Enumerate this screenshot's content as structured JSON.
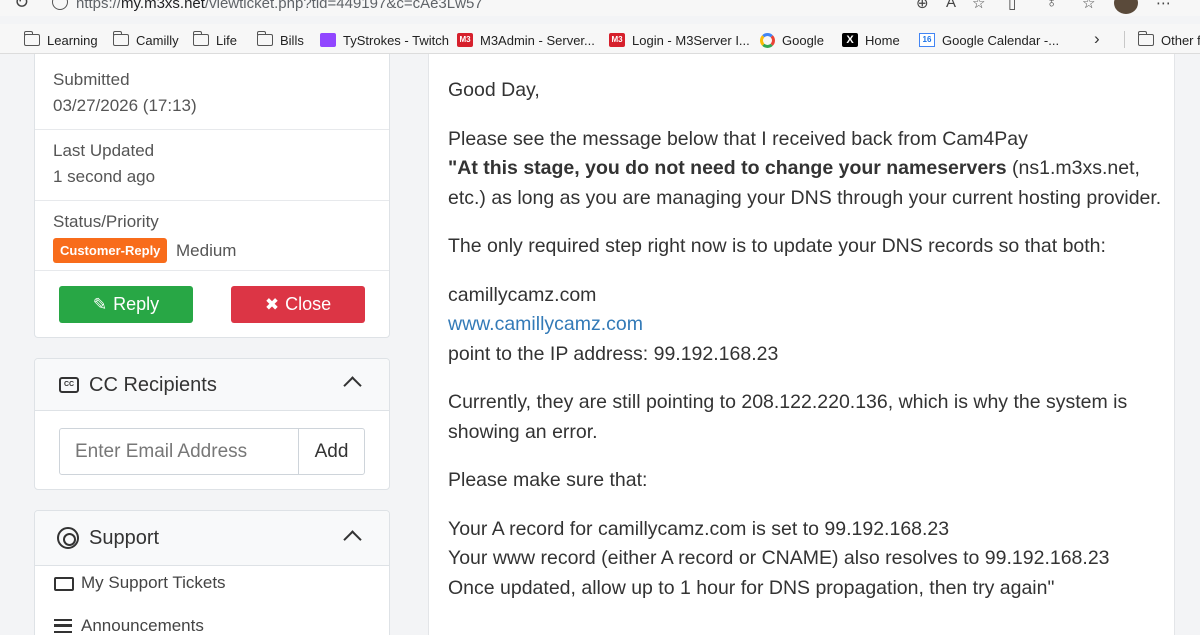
{
  "browser": {
    "url_prefix": "https://",
    "url_host": "my.m3xs.net",
    "url_path": "/viewticket.php?tid=449197&c=cAe3Lw57"
  },
  "bookmarks": [
    {
      "label": "Learning",
      "icon": "folder-icon"
    },
    {
      "label": "Camilly",
      "icon": "folder-icon"
    },
    {
      "label": "Life",
      "icon": "folder-icon"
    },
    {
      "label": "Bills",
      "icon": "folder-icon"
    },
    {
      "label": "TyStrokes - Twitch",
      "icon": "twitch-icon"
    },
    {
      "label": "M3Admin - Server...",
      "icon": "m3-icon"
    },
    {
      "label": "Login - M3Server I...",
      "icon": "m3-icon"
    },
    {
      "label": "Google",
      "icon": "google-icon"
    },
    {
      "label": "Home",
      "icon": "x-icon"
    },
    {
      "label": "Google Calendar -...",
      "icon": "calendar-icon"
    }
  ],
  "other_bookmarks": "Other fa",
  "ticket": {
    "submitted_label": "Submitted",
    "submitted_value": "03/27/2026 (17:13)",
    "updated_label": "Last Updated",
    "updated_value": "1 second ago",
    "status_label": "Status/Priority",
    "status_badge": "Customer-Reply",
    "priority": "Medium",
    "reply_label": "Reply",
    "close_label": "Close",
    "colors": {
      "reply": "#28a745",
      "close": "#dc3545",
      "badge": "#f86c1b"
    }
  },
  "cc": {
    "title": "CC Recipients",
    "placeholder": "Enter Email Address",
    "add_label": "Add"
  },
  "support": {
    "title": "Support",
    "items": [
      "My Support Tickets",
      "Announcements"
    ]
  },
  "message": {
    "greeting": "Good Day,",
    "intro": "Please see the message below that I received back from Cam4Pay",
    "quote_bold": "\"At this stage, you do not need to change your nameservers",
    "quote_rest": " (ns1.m3xs.net, etc.) as long as you are managing your DNS through your current hosting provider.",
    "required": "The only required step right now is to update your DNS records so that both:",
    "domain1": "camillycamz.com",
    "domain2": "www.camillycamz.com",
    "point_to": "point to the IP address: 99.192.168.23",
    "currently": "Currently, they are still pointing to 208.122.220.136, which is why the system is showing an error.",
    "make_sure": "Please make sure that:",
    "a_record": "Your A record for camillycamz.com is set to 99.192.168.23",
    "www_record": "Your www record (either A record or CNAME) also resolves to 99.192.168.23",
    "once_updated": "Once updated, allow up to 1 hour for DNS propagation, then try again\""
  }
}
